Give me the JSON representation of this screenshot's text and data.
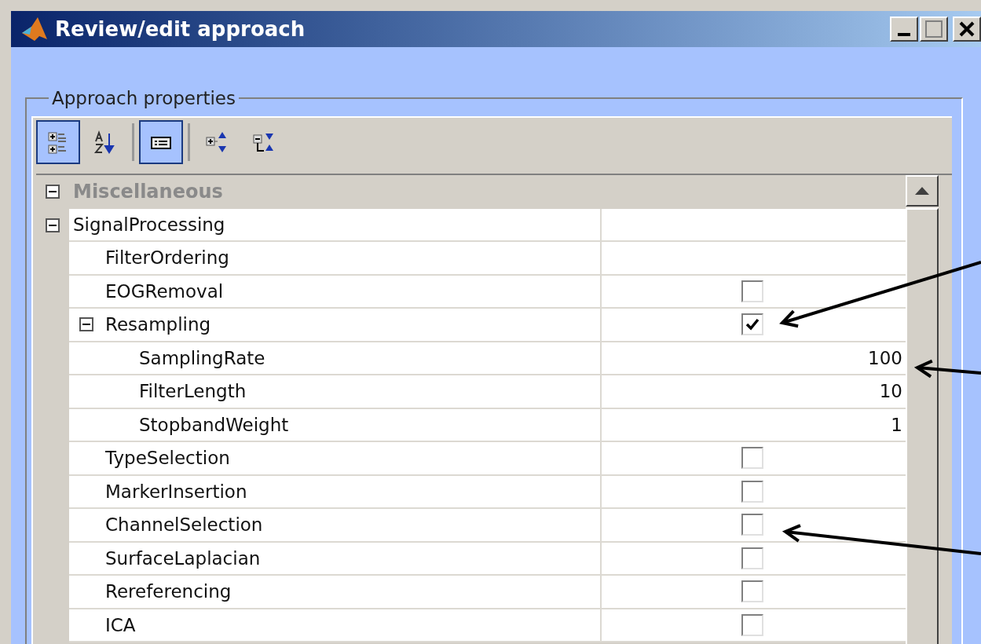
{
  "window": {
    "title": "Review/edit approach"
  },
  "group": {
    "label": "Approach properties"
  },
  "toolbar": [
    {
      "kind": "categorized",
      "selected": true
    },
    {
      "kind": "sort",
      "selected": false
    },
    {
      "kind": "description",
      "selected": true
    },
    {
      "kind": "expand",
      "selected": false
    },
    {
      "kind": "collapse",
      "selected": false
    }
  ],
  "properties": [
    {
      "name": "Miscellaneous",
      "kind": "category",
      "expanded": true
    },
    {
      "name": "SignalProcessing",
      "kind": "none",
      "expanded": true,
      "children": [
        {
          "name": "FilterOrdering",
          "kind": "none"
        },
        {
          "name": "EOGRemoval",
          "kind": "checkbox",
          "checked": false
        },
        {
          "name": "Resampling",
          "kind": "checkbox",
          "checked": true,
          "expanded": true,
          "children": [
            {
              "name": "SamplingRate",
              "kind": "number",
              "value": "100"
            },
            {
              "name": "FilterLength",
              "kind": "number",
              "value": "10"
            },
            {
              "name": "StopbandWeight",
              "kind": "number",
              "value": "1"
            }
          ]
        },
        {
          "name": "TypeSelection",
          "kind": "checkbox",
          "checked": false
        },
        {
          "name": "MarkerInsertion",
          "kind": "checkbox",
          "checked": false
        },
        {
          "name": "ChannelSelection",
          "kind": "checkbox",
          "checked": false
        },
        {
          "name": "SurfaceLaplacian",
          "kind": "checkbox",
          "checked": false
        },
        {
          "name": "Rereferencing",
          "kind": "checkbox",
          "checked": false
        },
        {
          "name": "ICA",
          "kind": "checkbox",
          "checked": false
        }
      ]
    }
  ]
}
